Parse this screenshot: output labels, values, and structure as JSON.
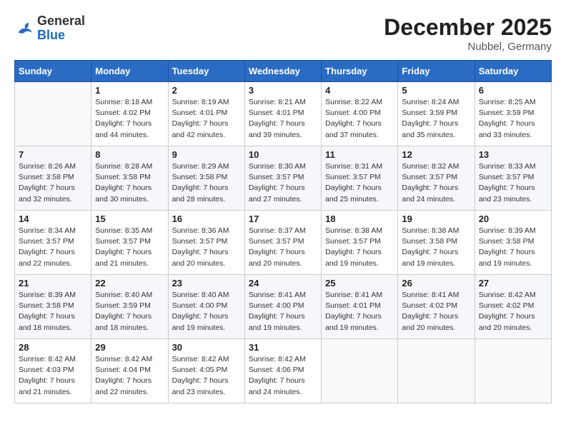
{
  "header": {
    "logo_general": "General",
    "logo_blue": "Blue",
    "month_title": "December 2025",
    "location": "Nubbel, Germany"
  },
  "weekdays": [
    "Sunday",
    "Monday",
    "Tuesday",
    "Wednesday",
    "Thursday",
    "Friday",
    "Saturday"
  ],
  "weeks": [
    [
      {
        "day": "",
        "sunrise": "",
        "sunset": "",
        "daylight": ""
      },
      {
        "day": "1",
        "sunrise": "Sunrise: 8:18 AM",
        "sunset": "Sunset: 4:02 PM",
        "daylight": "Daylight: 7 hours and 44 minutes."
      },
      {
        "day": "2",
        "sunrise": "Sunrise: 8:19 AM",
        "sunset": "Sunset: 4:01 PM",
        "daylight": "Daylight: 7 hours and 42 minutes."
      },
      {
        "day": "3",
        "sunrise": "Sunrise: 8:21 AM",
        "sunset": "Sunset: 4:01 PM",
        "daylight": "Daylight: 7 hours and 39 minutes."
      },
      {
        "day": "4",
        "sunrise": "Sunrise: 8:22 AM",
        "sunset": "Sunset: 4:00 PM",
        "daylight": "Daylight: 7 hours and 37 minutes."
      },
      {
        "day": "5",
        "sunrise": "Sunrise: 8:24 AM",
        "sunset": "Sunset: 3:59 PM",
        "daylight": "Daylight: 7 hours and 35 minutes."
      },
      {
        "day": "6",
        "sunrise": "Sunrise: 8:25 AM",
        "sunset": "Sunset: 3:59 PM",
        "daylight": "Daylight: 7 hours and 33 minutes."
      }
    ],
    [
      {
        "day": "7",
        "sunrise": "Sunrise: 8:26 AM",
        "sunset": "Sunset: 3:58 PM",
        "daylight": "Daylight: 7 hours and 32 minutes."
      },
      {
        "day": "8",
        "sunrise": "Sunrise: 8:28 AM",
        "sunset": "Sunset: 3:58 PM",
        "daylight": "Daylight: 7 hours and 30 minutes."
      },
      {
        "day": "9",
        "sunrise": "Sunrise: 8:29 AM",
        "sunset": "Sunset: 3:58 PM",
        "daylight": "Daylight: 7 hours and 28 minutes."
      },
      {
        "day": "10",
        "sunrise": "Sunrise: 8:30 AM",
        "sunset": "Sunset: 3:57 PM",
        "daylight": "Daylight: 7 hours and 27 minutes."
      },
      {
        "day": "11",
        "sunrise": "Sunrise: 8:31 AM",
        "sunset": "Sunset: 3:57 PM",
        "daylight": "Daylight: 7 hours and 25 minutes."
      },
      {
        "day": "12",
        "sunrise": "Sunrise: 8:32 AM",
        "sunset": "Sunset: 3:57 PM",
        "daylight": "Daylight: 7 hours and 24 minutes."
      },
      {
        "day": "13",
        "sunrise": "Sunrise: 8:33 AM",
        "sunset": "Sunset: 3:57 PM",
        "daylight": "Daylight: 7 hours and 23 minutes."
      }
    ],
    [
      {
        "day": "14",
        "sunrise": "Sunrise: 8:34 AM",
        "sunset": "Sunset: 3:57 PM",
        "daylight": "Daylight: 7 hours and 22 minutes."
      },
      {
        "day": "15",
        "sunrise": "Sunrise: 8:35 AM",
        "sunset": "Sunset: 3:57 PM",
        "daylight": "Daylight: 7 hours and 21 minutes."
      },
      {
        "day": "16",
        "sunrise": "Sunrise: 8:36 AM",
        "sunset": "Sunset: 3:57 PM",
        "daylight": "Daylight: 7 hours and 20 minutes."
      },
      {
        "day": "17",
        "sunrise": "Sunrise: 8:37 AM",
        "sunset": "Sunset: 3:57 PM",
        "daylight": "Daylight: 7 hours and 20 minutes."
      },
      {
        "day": "18",
        "sunrise": "Sunrise: 8:38 AM",
        "sunset": "Sunset: 3:57 PM",
        "daylight": "Daylight: 7 hours and 19 minutes."
      },
      {
        "day": "19",
        "sunrise": "Sunrise: 8:38 AM",
        "sunset": "Sunset: 3:58 PM",
        "daylight": "Daylight: 7 hours and 19 minutes."
      },
      {
        "day": "20",
        "sunrise": "Sunrise: 8:39 AM",
        "sunset": "Sunset: 3:58 PM",
        "daylight": "Daylight: 7 hours and 19 minutes."
      }
    ],
    [
      {
        "day": "21",
        "sunrise": "Sunrise: 8:39 AM",
        "sunset": "Sunset: 3:58 PM",
        "daylight": "Daylight: 7 hours and 18 minutes."
      },
      {
        "day": "22",
        "sunrise": "Sunrise: 8:40 AM",
        "sunset": "Sunset: 3:59 PM",
        "daylight": "Daylight: 7 hours and 18 minutes."
      },
      {
        "day": "23",
        "sunrise": "Sunrise: 8:40 AM",
        "sunset": "Sunset: 4:00 PM",
        "daylight": "Daylight: 7 hours and 19 minutes."
      },
      {
        "day": "24",
        "sunrise": "Sunrise: 8:41 AM",
        "sunset": "Sunset: 4:00 PM",
        "daylight": "Daylight: 7 hours and 19 minutes."
      },
      {
        "day": "25",
        "sunrise": "Sunrise: 8:41 AM",
        "sunset": "Sunset: 4:01 PM",
        "daylight": "Daylight: 7 hours and 19 minutes."
      },
      {
        "day": "26",
        "sunrise": "Sunrise: 8:41 AM",
        "sunset": "Sunset: 4:02 PM",
        "daylight": "Daylight: 7 hours and 20 minutes."
      },
      {
        "day": "27",
        "sunrise": "Sunrise: 8:42 AM",
        "sunset": "Sunset: 4:02 PM",
        "daylight": "Daylight: 7 hours and 20 minutes."
      }
    ],
    [
      {
        "day": "28",
        "sunrise": "Sunrise: 8:42 AM",
        "sunset": "Sunset: 4:03 PM",
        "daylight": "Daylight: 7 hours and 21 minutes."
      },
      {
        "day": "29",
        "sunrise": "Sunrise: 8:42 AM",
        "sunset": "Sunset: 4:04 PM",
        "daylight": "Daylight: 7 hours and 22 minutes."
      },
      {
        "day": "30",
        "sunrise": "Sunrise: 8:42 AM",
        "sunset": "Sunset: 4:05 PM",
        "daylight": "Daylight: 7 hours and 23 minutes."
      },
      {
        "day": "31",
        "sunrise": "Sunrise: 8:42 AM",
        "sunset": "Sunset: 4:06 PM",
        "daylight": "Daylight: 7 hours and 24 minutes."
      },
      {
        "day": "",
        "sunrise": "",
        "sunset": "",
        "daylight": ""
      },
      {
        "day": "",
        "sunrise": "",
        "sunset": "",
        "daylight": ""
      },
      {
        "day": "",
        "sunrise": "",
        "sunset": "",
        "daylight": ""
      }
    ]
  ]
}
